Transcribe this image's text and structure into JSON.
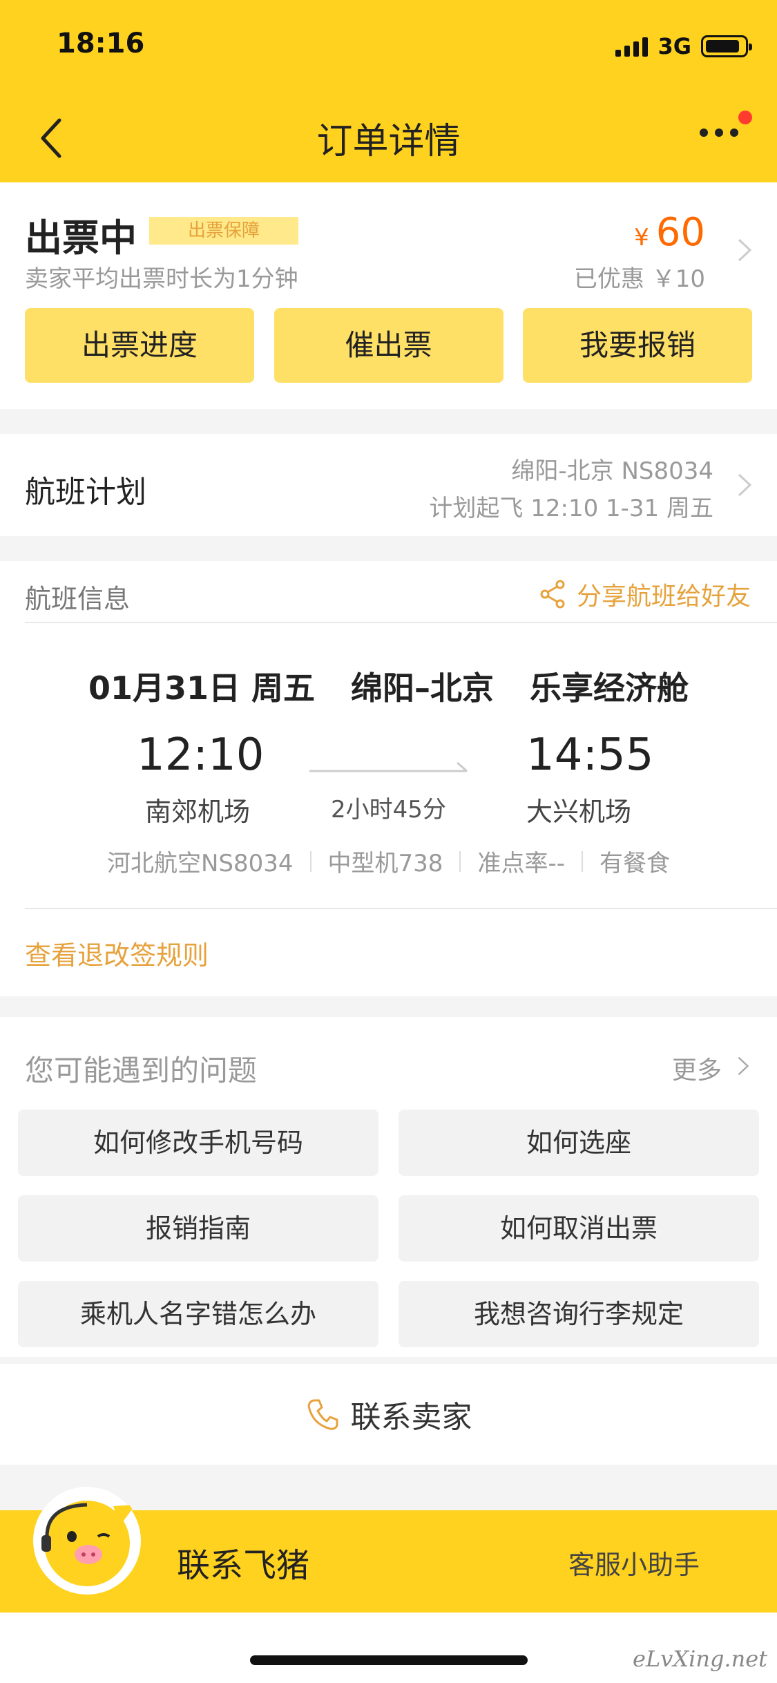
{
  "status_bar": {
    "time": "18:16",
    "network": "3G"
  },
  "nav": {
    "title": "订单详情"
  },
  "ticket_status": {
    "title": "出票中",
    "tag": "出票保障",
    "subtitle": "卖家平均出票时长为1分钟",
    "currency": "¥",
    "price": "60",
    "discount": "已优惠 ￥10",
    "buttons": [
      "出票进度",
      "催出票",
      "我要报销"
    ]
  },
  "flight_plan": {
    "label": "航班计划",
    "route": "绵阳-北京 NS8034",
    "time": "计划起飞 12:10 1-31 周五"
  },
  "flight_info": {
    "label": "航班信息",
    "share": "分享航班给好友",
    "date": "01月31日 周五",
    "route": "绵阳–北京",
    "cabin": "乐享经济舱",
    "depart_time": "12:10",
    "depart_airport": "南郊机场",
    "duration": "2小时45分",
    "arrive_time": "14:55",
    "arrive_airport": "大兴机场",
    "meta": [
      "河北航空NS8034",
      "中型机738",
      "准点率--",
      "有餐食"
    ],
    "rules_link": "查看退改签规则"
  },
  "questions": {
    "title": "您可能遇到的问题",
    "more": "更多",
    "items": [
      "如何修改手机号码",
      "如何选座",
      "报销指南",
      "如何取消出票",
      "乘机人名字错怎么办",
      "我想咨询行李规定"
    ]
  },
  "contact_seller": "联系卖家",
  "bottom": {
    "title": "联系飞猪",
    "subtitle": "客服小助手"
  },
  "watermark": "eLvXing.net",
  "colors": {
    "brand_yellow": "#ffd21f",
    "button_yellow": "#ffe066",
    "price_orange": "#ff6a00",
    "link_orange": "#e6a23c"
  }
}
